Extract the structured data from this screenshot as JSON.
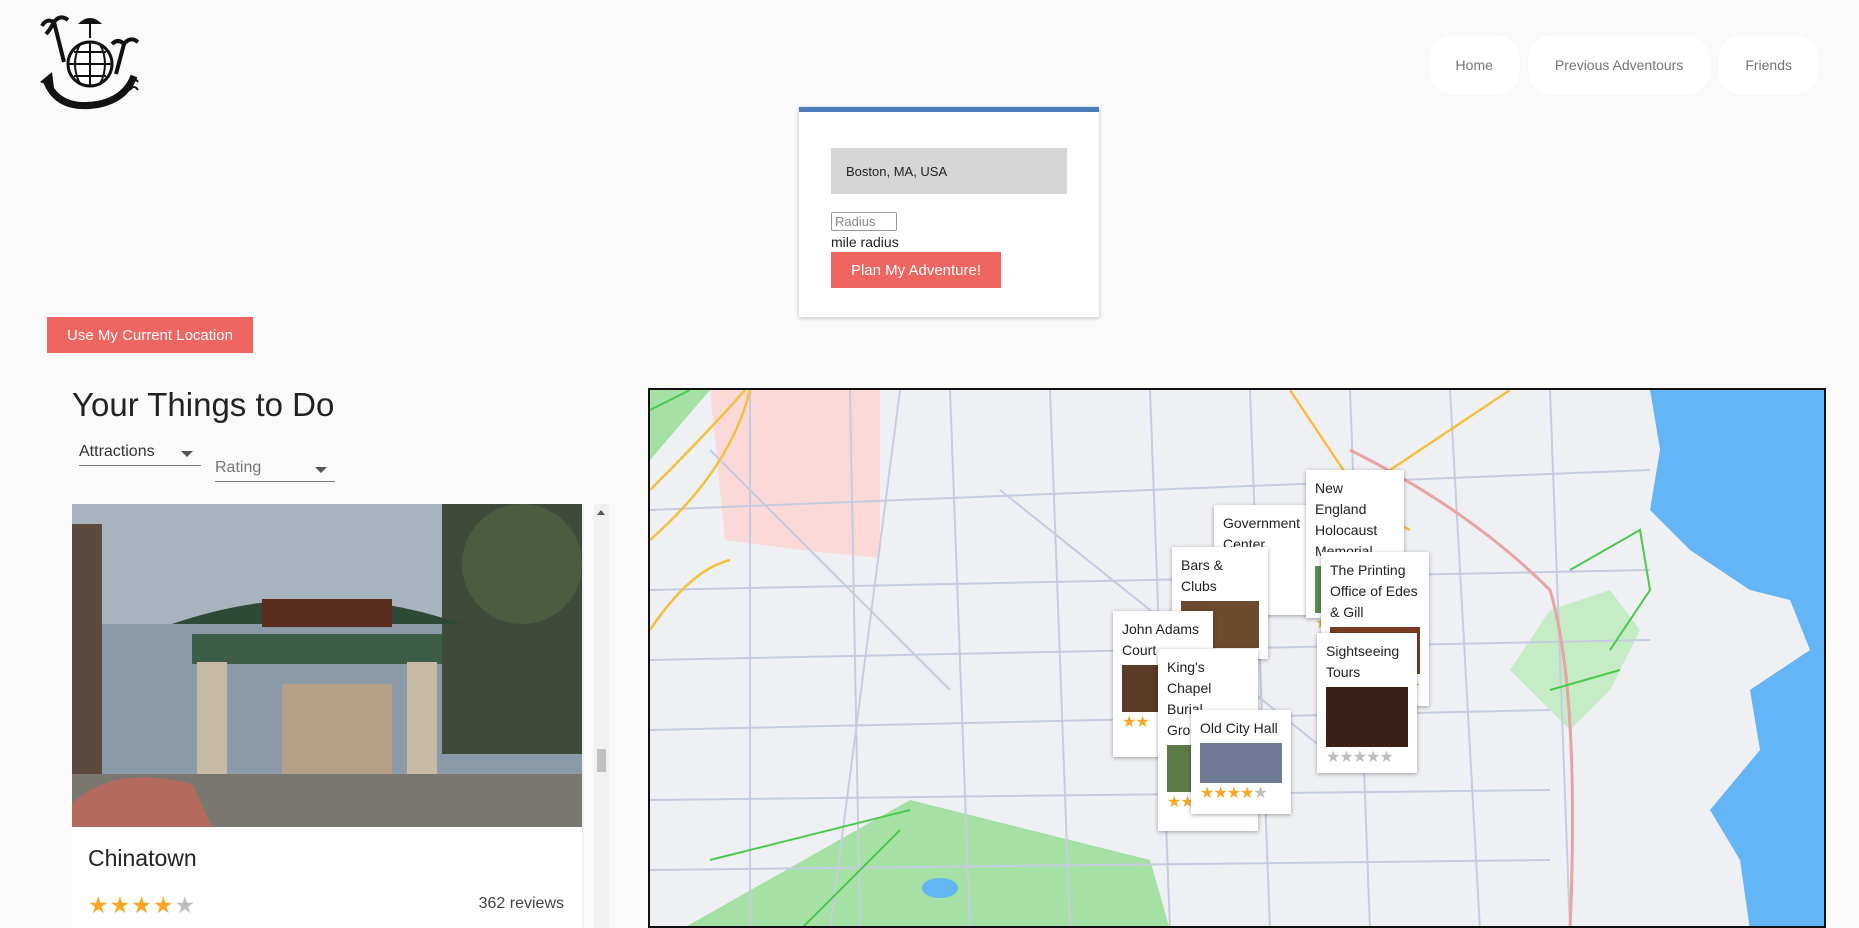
{
  "nav": {
    "items": [
      "Home",
      "Previous Adventours",
      "Friends"
    ]
  },
  "search": {
    "location_value": "Boston, MA, USA",
    "radius_placeholder": "Radius",
    "radius_unit": "mile radius",
    "plan_button": "Plan My Adventure!"
  },
  "location_button": "Use My Current Location",
  "list": {
    "title": "Your Things to Do",
    "type_filter": "Attractions",
    "rating_filter": "Rating",
    "first_card": {
      "name": "Chinatown",
      "rating": 4,
      "reviews": "362 reviews"
    }
  },
  "map": {
    "markers": [
      {
        "label": "Government Center"
      },
      {
        "label": "New England Holocaust Memorial"
      },
      {
        "label": "Bars & Clubs"
      },
      {
        "label": "The Printing Office of Edes & Gill"
      },
      {
        "label": "John Adams Court"
      },
      {
        "label": "King's Chapel Burial Ground"
      },
      {
        "label": "Sightseeing Tours"
      },
      {
        "label": "Old City Hall"
      }
    ]
  },
  "colors": {
    "accent": "#ef6560",
    "search_border": "#4a7eb8",
    "star": "#f9a825",
    "map_water": "#64b5f6",
    "map_park": "#a5e0a5"
  }
}
